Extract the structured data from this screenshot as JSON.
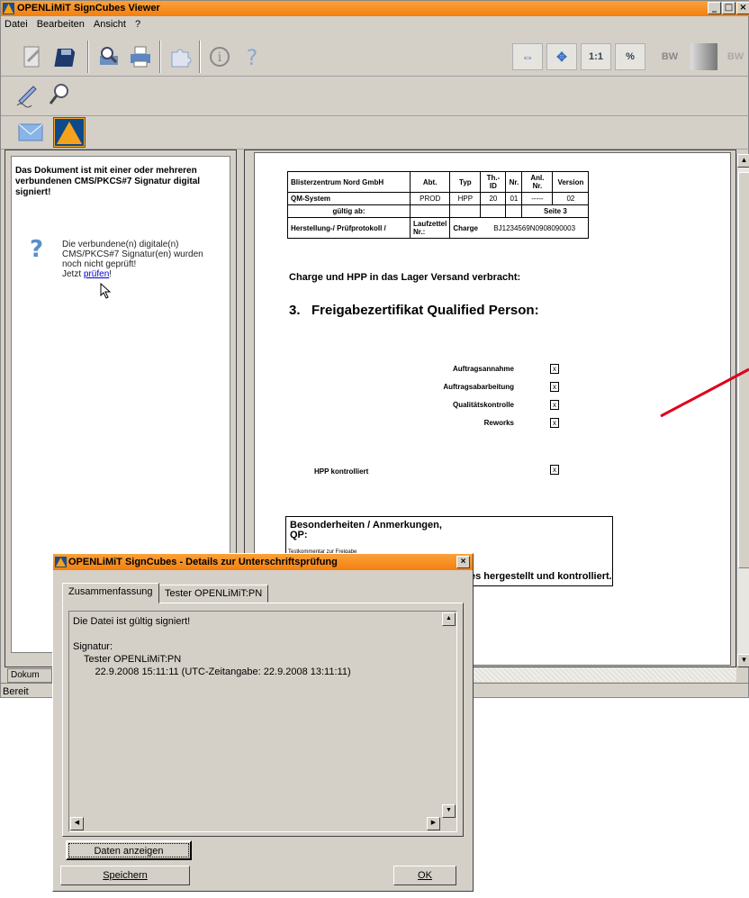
{
  "window": {
    "title": "OPENLiMiT SignCubes Viewer",
    "min": "_",
    "max": "□",
    "close": "×"
  },
  "menu": [
    "Datei",
    "Bearbeiten",
    "Ansicht",
    "?"
  ],
  "view_buttons": {
    "fit_width": "⇔",
    "fit_page": "✥",
    "actual": "1:1",
    "percent": "%",
    "bw": "BW",
    "bw2": "BW"
  },
  "left_panel": {
    "message": "Das Dokument ist mit einer oder mehreren verbundenen CMS/PKCS#7 Signatur digital signiert!",
    "question": "?",
    "status_lines": "Die verbundene(n) digitale(n) CMS/PKCS#7 Signatur(en) wurden noch nicht geprüft!",
    "check_prefix": "Jetzt ",
    "check_link": "prüfen",
    "check_suffix": "!"
  },
  "tab_doc": "Dokum",
  "status": "Bereit",
  "document": {
    "header": {
      "company": "Blisterzentrum Nord GmbH",
      "abt_h": "Abt.",
      "typ_h": "Typ",
      "thid_h": "Th.-ID",
      "nr_h": "Nr.",
      "anl_h": "Anl. Nr.",
      "ver_h": "Version",
      "system": "QM-System",
      "abt": "PROD",
      "typ": "HPP",
      "thid": "20",
      "nr": "01",
      "anl": "-----",
      "ver": "02",
      "valid": "gültig ab:",
      "page": "Seite 3",
      "protocol": "Herstellung-/ Prüfprotokoll /",
      "laufzettel": "Laufzettel Nr.:",
      "charge": "Charge",
      "charge_no": "BJ1234569N0908090003"
    },
    "line1": "Charge und HPP in das Lager Versand verbracht:",
    "heading": "3.   Freigabezertifikat Qualified Person:",
    "checks": [
      "Auftragsannahme",
      "Auftragsabarbeitung",
      "Qualitätskontrolle",
      "Reworks"
    ],
    "check_mark": "x",
    "hpp": "HPP kontrolliert",
    "remarks_title": "Besonderheiten / Anmerkungen,\nQP:",
    "remarks_comment": "Testkommentar zur Freigabe",
    "remarks_tail": "es hergestellt und kontrolliert."
  },
  "dialog": {
    "title": "OPENLiMiT SignCubes - Details zur Unterschriftsprüfung",
    "close": "×",
    "tabs": [
      "Zusammenfassung",
      "Tester OPENLiMiT:PN"
    ],
    "text": "Die Datei ist gültig signiert!\n\nSignatur:\n    Tester OPENLiMiT:PN\n        22.9.2008 15:11:11 (UTC-Zeitangabe: 22.9.2008 13:11:11)",
    "show_data": "Daten anzeigen",
    "save": "Speichern",
    "ok": "OK"
  },
  "colors": {
    "title_orange": "#f47f0f",
    "annotation_red": "#e0001a",
    "chrome": "#d4d0c8"
  }
}
